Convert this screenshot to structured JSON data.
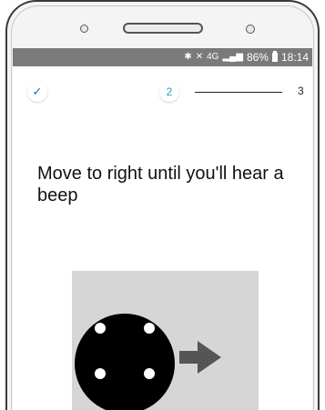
{
  "status_bar": {
    "network": "4G",
    "battery": "86%",
    "time": "18:14",
    "icons": [
      "bluetooth-icon",
      "mute-icon",
      "signal-icon",
      "battery-icon"
    ]
  },
  "stepper": {
    "step1_icon": "✓",
    "step2_label": "2",
    "step3_label": "3",
    "active_color": "#27a0a8",
    "done_color": "#1f6bb5"
  },
  "instruction": {
    "text": "Move to right until you'll hear a beep"
  },
  "illustration": {
    "background": "#d6d6d6",
    "icons": [
      "disc-icon",
      "arrow-right-icon"
    ]
  }
}
